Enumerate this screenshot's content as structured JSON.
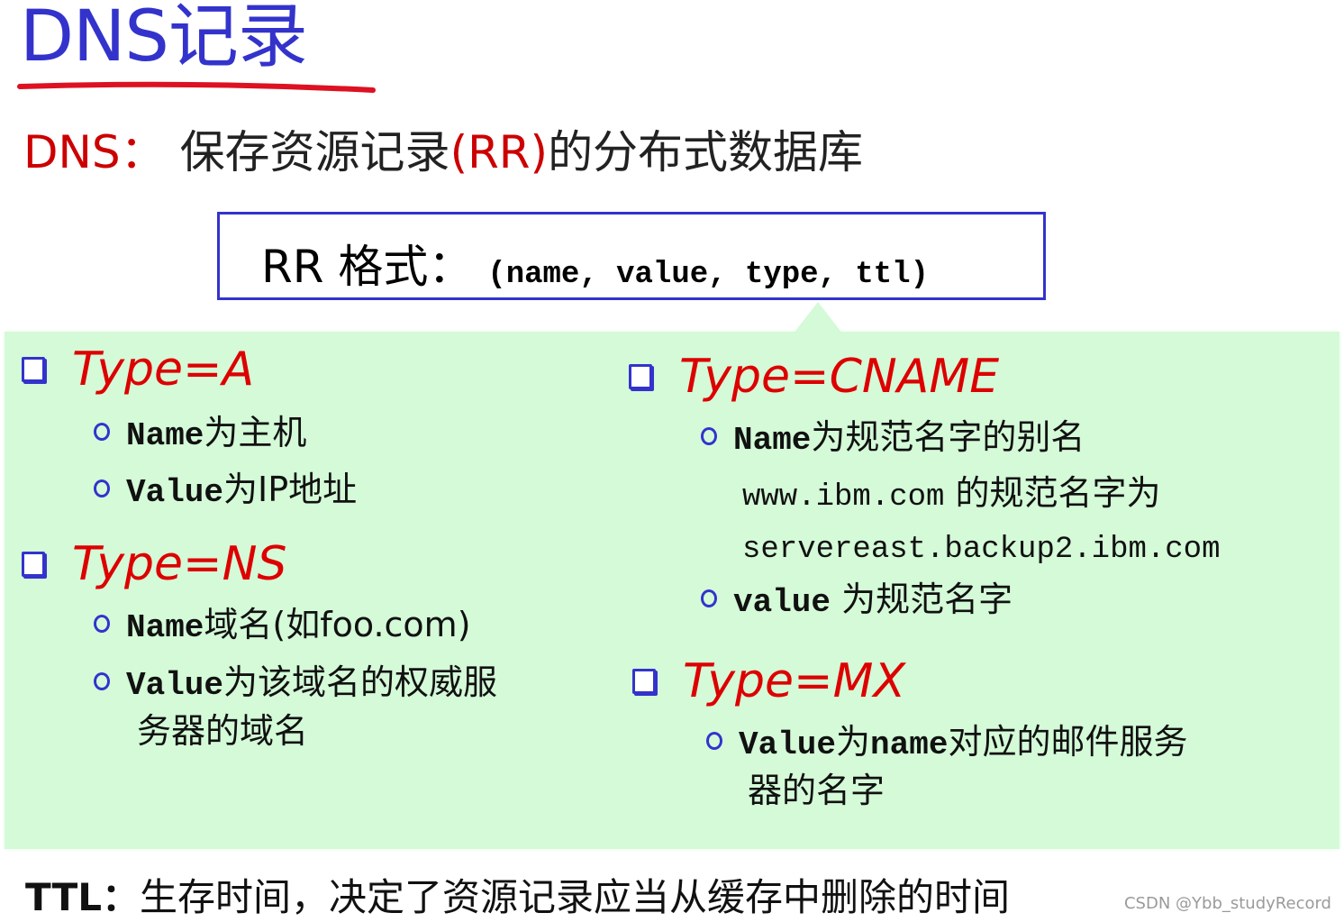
{
  "title": "DNS记录",
  "subtitle": {
    "prefix": "DNS：",
    "text1": "保存资源记录",
    "rr": "(RR)",
    "text2": "的分布式数据库"
  },
  "rr_format": {
    "label": "RR 格式：",
    "fields": "(name, value, type, ttl)"
  },
  "sections": {
    "type_a": {
      "title": "Type=A",
      "items": [
        {
          "key": "Name",
          "text": "为主机"
        },
        {
          "key": "Value",
          "text": "为IP地址"
        }
      ]
    },
    "type_ns": {
      "title": "Type=NS",
      "items": [
        {
          "key": "Name",
          "text": "域名(如foo.com)"
        },
        {
          "key": "Value",
          "text": "为该域名的权威服",
          "cont": "务器的域名"
        }
      ]
    },
    "type_cname": {
      "title": "Type=CNAME",
      "items": [
        {
          "key": "Name",
          "text": "为规范名字的别名"
        },
        {
          "key": "value",
          "text": " 为规范名字"
        }
      ],
      "example_line1_mono": "www.ibm.com",
      "example_line1_text": " 的规范名字为",
      "example_line2_mono": "servereast.backup2.ibm.com"
    },
    "type_mx": {
      "title": "Type=MX",
      "items": [
        {
          "key": "Value",
          "mid": "为",
          "key2": "name",
          "text": "对应的邮件服务",
          "cont": "器的名字"
        }
      ]
    }
  },
  "ttl": {
    "label": "TTL：",
    "text": "生存时间，决定了资源记录应当从缓存中删除的时间"
  },
  "watermark": "CSDN @Ybb_studyRecord",
  "colors": {
    "title_blue": "#3333cc",
    "accent_red": "#dd0000",
    "panel_green": "#d4fad8"
  }
}
